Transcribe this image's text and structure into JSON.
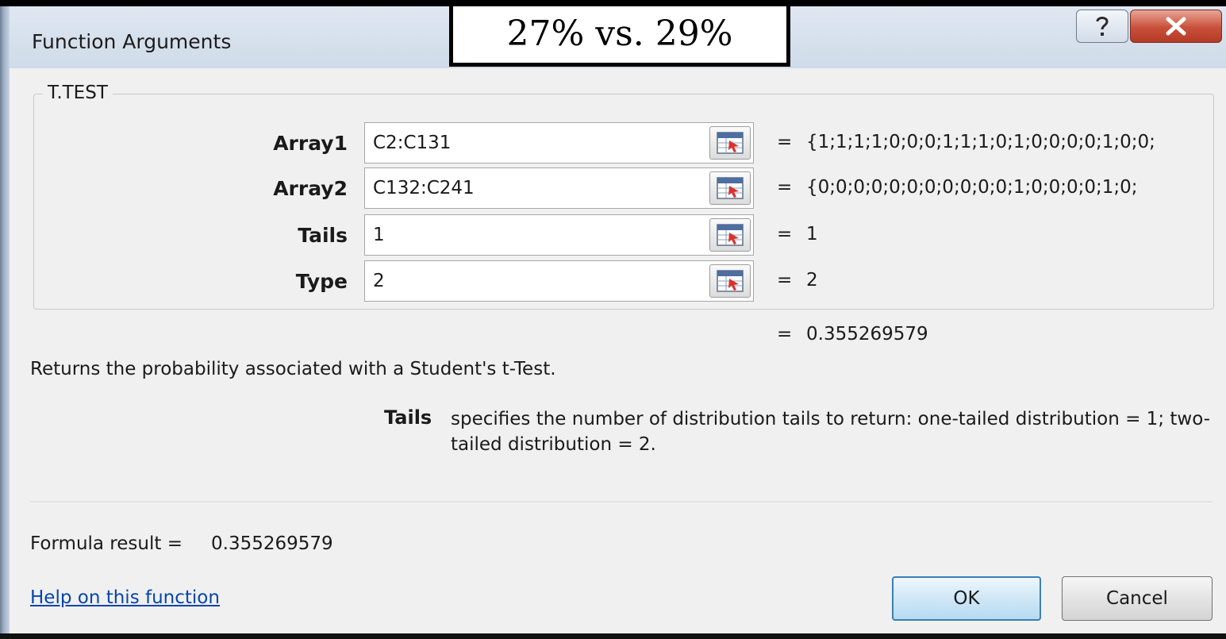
{
  "window": {
    "title": "Function Arguments"
  },
  "annotation": {
    "text": "27% vs. 29%"
  },
  "titlebar_buttons": {
    "help_icon": "question-icon",
    "close_icon": "close-icon"
  },
  "group": {
    "name": "T.TEST"
  },
  "arguments": [
    {
      "label": "Array1",
      "value": "C2:C131",
      "result": "{1;1;1;1;0;0;0;1;1;1;0;1;0;0;0;0;1;0;0;"
    },
    {
      "label": "Array2",
      "value": "C132:C241",
      "result": "{0;0;0;0;0;0;0;0;0;0;0;1;0;0;0;0;1;0;"
    },
    {
      "label": "Tails",
      "value": "1",
      "result": "1"
    },
    {
      "label": "Type",
      "value": "2",
      "result": "2"
    }
  ],
  "eq": "=",
  "result": "0.355269579",
  "description": "Returns the probability associated with a Student's t-Test.",
  "arg_help": {
    "name": "Tails",
    "text": "specifies the number of distribution tails to return: one-tailed distribution = 1; two-tailed distribution = 2."
  },
  "formula_result": {
    "label": "Formula result =",
    "value": "0.355269579"
  },
  "help_link": "Help on this function",
  "buttons": {
    "ok": "OK",
    "cancel": "Cancel"
  }
}
